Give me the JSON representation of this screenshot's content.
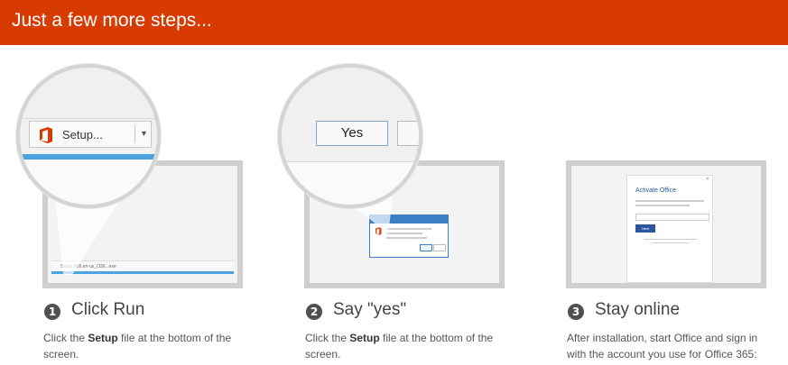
{
  "banner": {
    "title": "Just a few more steps..."
  },
  "steps": [
    {
      "number": "1",
      "title": "Click Run",
      "desc_prefix": "Click the ",
      "desc_bold": "Setup",
      "desc_suffix": " file at the bottom of the screen.",
      "zoom_button_label": "Setup...",
      "download_item": "Setup.X86.en-us_O36...exe"
    },
    {
      "number": "2",
      "title": "Say \"yes\"",
      "desc_prefix": "Click the ",
      "desc_bold": "Setup",
      "desc_suffix": " file at the bottom of the screen.",
      "zoom_button_label": "Yes"
    },
    {
      "number": "3",
      "title": "Stay online",
      "desc_text": "After installation, start Office and sign in with the account you use for Office 365:",
      "dialog_title": "Activate Office",
      "dialog_button": "Next"
    }
  ],
  "colors": {
    "banner": "#d83b01",
    "accent_blue": "#4aa3df",
    "office_orange": "#d83b01",
    "office_blue": "#2b579a"
  }
}
